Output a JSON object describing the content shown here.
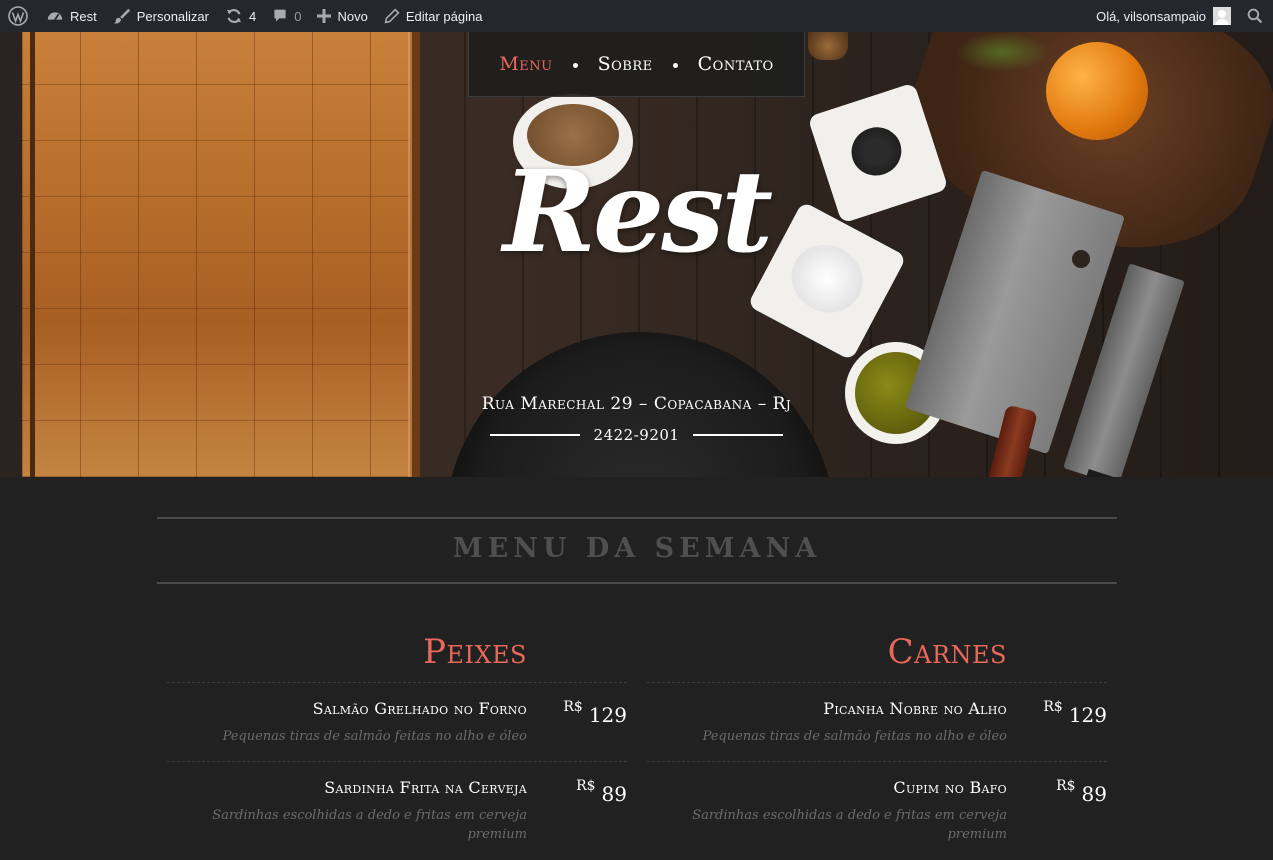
{
  "adminbar": {
    "site_name": "Rest",
    "customize": "Personalizar",
    "updates_count": "4",
    "comments_count": "0",
    "new_label": "Novo",
    "edit_label": "Editar página",
    "greeting": "Olá, vilsonsampaio"
  },
  "nav": {
    "items": [
      "Menu",
      "Sobre",
      "Contato"
    ],
    "active": "Menu"
  },
  "hero": {
    "logo": "Rest",
    "address": "Rua Marechal 29 – Copacabana – Rj",
    "phone": "2422-9201"
  },
  "menu": {
    "title": "MENU DA SEMANA",
    "categories": [
      {
        "name": "Peixes",
        "items": [
          {
            "name": "Salmão Grelhado no Forno",
            "desc": "Pequenas tiras de salmão feitas no alho e óleo",
            "currency": "R$",
            "price": "129"
          },
          {
            "name": "Sardinha Frita na Cerveja",
            "desc": "Sardinhas escolhidas a dedo e fritas em cerveja premium",
            "currency": "R$",
            "price": "89"
          }
        ]
      },
      {
        "name": "Carnes",
        "items": [
          {
            "name": "Picanha Nobre no Alho",
            "desc": "Pequenas tiras de salmão feitas no alho e óleo",
            "currency": "R$",
            "price": "129"
          },
          {
            "name": "Cupim no Bafo",
            "desc": "Sardinhas escolhidas a dedo e fritas em cerveja premium",
            "currency": "R$",
            "price": "89"
          }
        ]
      }
    ]
  },
  "colors": {
    "accent": "#e8685a",
    "admin_bar": "#23282d",
    "background": "#212121"
  },
  "icons": [
    "wordpress-icon",
    "dashboard-icon",
    "brush-icon",
    "updates-icon",
    "comment-icon",
    "plus-icon",
    "pencil-icon",
    "avatar",
    "search-icon"
  ]
}
